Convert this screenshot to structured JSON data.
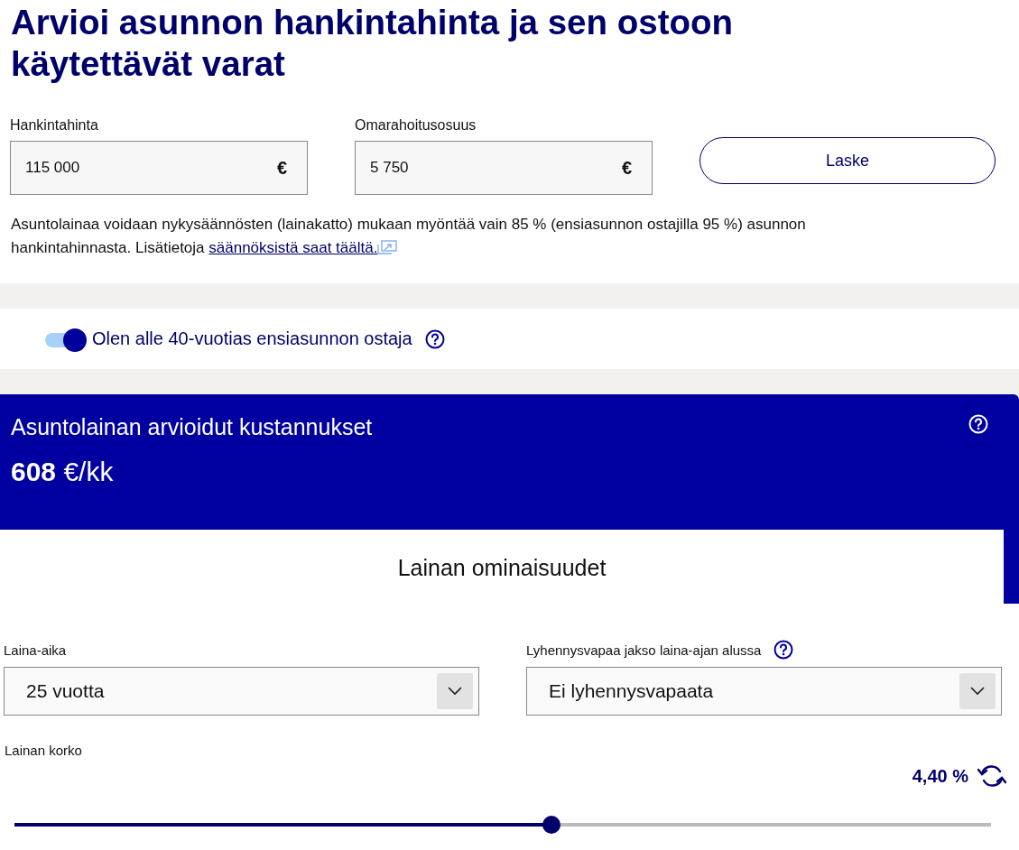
{
  "title": "Arvioi asunnon hankintahinta ja sen ostoon käytettävät varat",
  "fields": [
    {
      "label": "Hankintahinta",
      "value": "115 000",
      "unit": "€"
    },
    {
      "label": "Omarahoitusosuus",
      "value": "5 750",
      "unit": "€"
    }
  ],
  "calculate_button": "Laske",
  "note": {
    "text": "Asuntolainaa voidaan nykysäännösten (lainakatto) mukaan myöntää vain 85 % (ensiasunnon ostajilla 95 %) asunnon hankintahinnasta. Lisätietoja ",
    "link": "säännöksistä saat täältä."
  },
  "first_home_toggle": {
    "label": "Olen alle 40-vuotias ensiasunnon ostaja",
    "on": true
  },
  "costs": {
    "title": "Asuntolainan arvioidut kustannukset",
    "amount": "**608** €/kk"
  },
  "card_title": "Lainan ominaisuudet",
  "selects": [
    {
      "label": "Laina-aika",
      "value": "25 vuotta",
      "help": false
    },
    {
      "label": "Lyhennysvapaa jakso laina-ajan alussa",
      "value": "Ei lyhennysvapaata",
      "help": true
    }
  ],
  "interest": {
    "label": "Lainan korko",
    "reading": "4,40 %",
    "level": 0.55
  }
}
